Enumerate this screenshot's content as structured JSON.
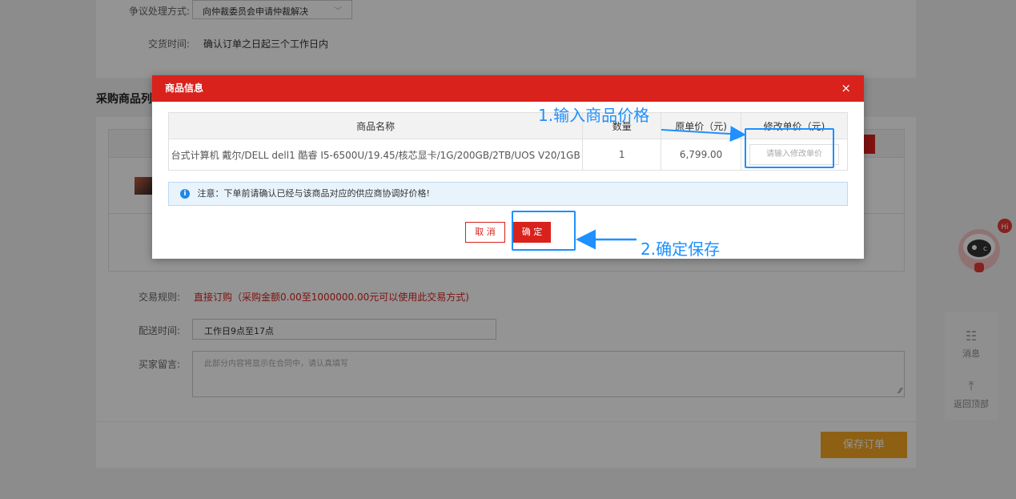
{
  "background": {
    "dispute_label": "争议处理方式:",
    "dispute_value": "向仲裁委员会申请仲裁解决",
    "delivery_label": "交货时间:",
    "delivery_value": "确认订单之日起三个工作日内",
    "section_title": "采购商品列",
    "rule_label": "交易规则:",
    "rule_value": "直接订购（采购金额0.00至1000000.00元可以使用此交易方式)",
    "shipping_label": "配送时间:",
    "shipping_value": "工作日9点至17点",
    "message_label": "买家留言:",
    "message_placeholder": "此部分内容将显示在合同中，请认真填写",
    "save_order": "保存订单"
  },
  "sidebar": {
    "message": "消息",
    "back_top": "返回顶部"
  },
  "modal": {
    "title": "商品信息",
    "close": "×",
    "columns": [
      "商品名称",
      "数量",
      "原单价（元)",
      "修改单价（元)"
    ],
    "rows": [
      {
        "name": "台式计算机 戴尔/DELL dell1 酷睿 I5-6500U/19.45/核芯显卡/1G/200GB/2TB/UOS V20/1GB",
        "qty": "1",
        "price": "6,799.00",
        "new_price_placeholder": "请输入修改单价"
      }
    ],
    "notice": "注意：下单前请确认已经与该商品对应的供应商协调好价格!",
    "cancel": "取 消",
    "confirm": "确 定"
  },
  "annotations": {
    "step1": "1.输入商品价格",
    "step2": "2.确定保存",
    "color": "#1e90ff"
  },
  "colors": {
    "primary": "#d9221c",
    "save_button": "#f5a623",
    "notice_bg": "#e8f3fc"
  }
}
